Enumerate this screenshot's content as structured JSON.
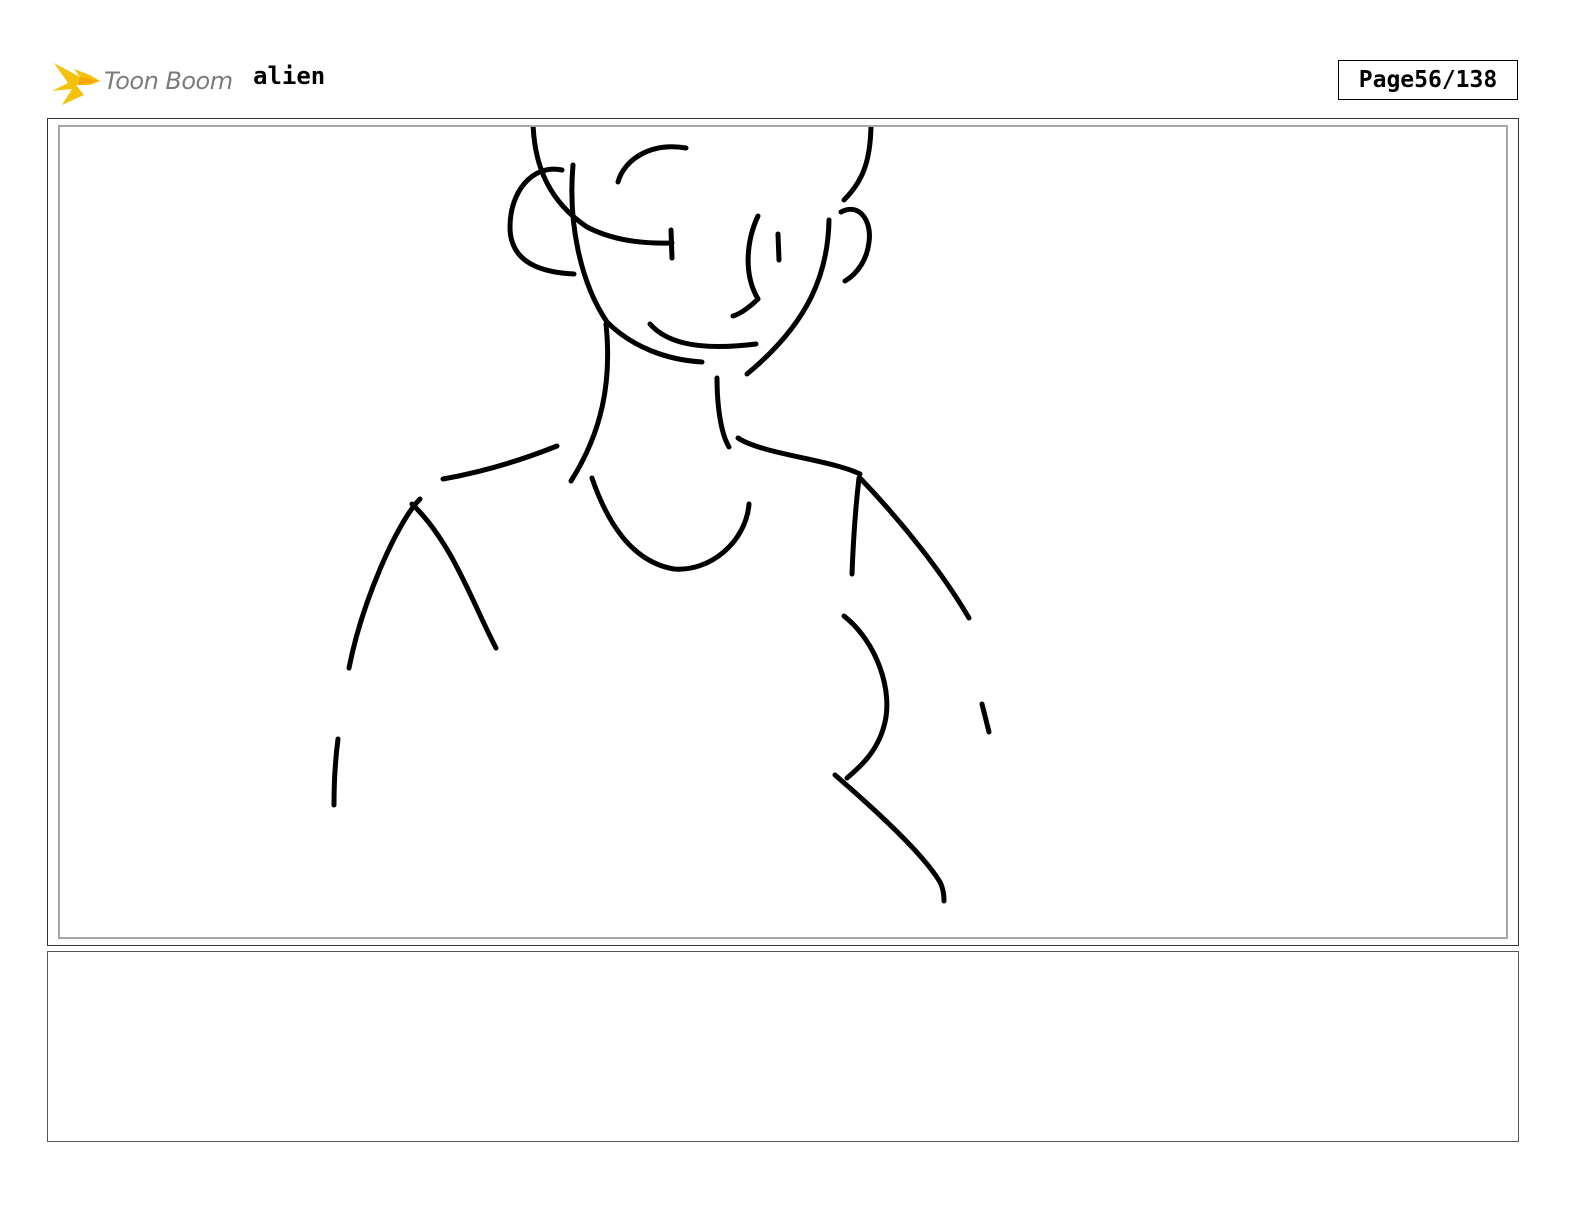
{
  "header": {
    "logo_text": "Toon Boom",
    "project_title": "alien",
    "page_label": "Page",
    "page_number": "56/138"
  },
  "panel": {
    "sketch_icon": "character-sketch"
  },
  "notes": {
    "text": ""
  }
}
